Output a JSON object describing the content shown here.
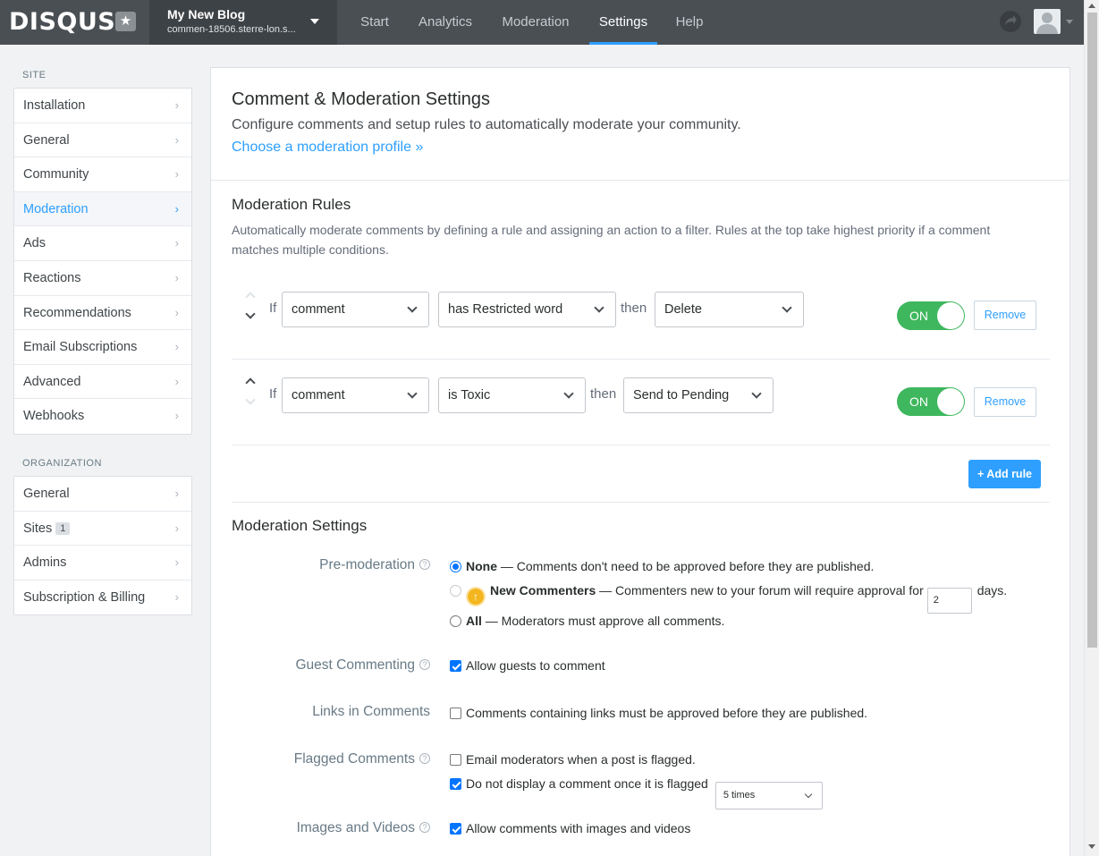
{
  "brand": {
    "logo_text": "DISQUS"
  },
  "site": {
    "name": "My New Blog",
    "url": "commen-18506.sterre-lon.s..."
  },
  "nav": {
    "tabs": [
      "Start",
      "Analytics",
      "Moderation",
      "Settings",
      "Help"
    ],
    "active": "Settings"
  },
  "sidebar": {
    "site_heading": "SITE",
    "site_items": [
      "Installation",
      "General",
      "Community",
      "Moderation",
      "Ads",
      "Reactions",
      "Recommendations",
      "Email Subscriptions",
      "Advanced",
      "Webhooks"
    ],
    "active_item": "Moderation",
    "org_heading": "ORGANIZATION",
    "org_items": [
      "General",
      "Sites",
      "Admins",
      "Subscription & Billing"
    ],
    "sites_count": "1"
  },
  "header": {
    "title": "Comment & Moderation Settings",
    "subtitle": "Configure comments and setup rules to automatically moderate your community.",
    "profile_link": "Choose a moderation profile »"
  },
  "rules": {
    "title": "Moderation Rules",
    "description": "Automatically moderate comments by defining a rule and assigning an action to a filter. Rules at the top take highest priority if a comment matches multiple conditions.",
    "if_label": "If",
    "then_label": "then",
    "items": [
      {
        "subject": "comment",
        "condition": "has Restricted word",
        "action": "Delete",
        "toggle": "ON",
        "remove": "Remove"
      },
      {
        "subject": "comment",
        "condition": "is Toxic",
        "action": "Send to Pending",
        "toggle": "ON",
        "remove": "Remove"
      }
    ],
    "add_button": "+ Add rule"
  },
  "settings": {
    "title": "Moderation Settings",
    "help_icon": "?",
    "premod": {
      "label": "Pre-moderation",
      "none_title": "None",
      "none_desc": " — Comments don't need to be approved before they are published.",
      "new_title": "New Commenters",
      "new_desc": " — Commenters new to your forum will require approval for",
      "days_value": "2",
      "days_label": "days.",
      "all_title": "All",
      "all_desc": " — Moderators must approve all comments.",
      "selected": "None"
    },
    "guest": {
      "label": "Guest Commenting",
      "option": "Allow guests to comment",
      "checked": true
    },
    "links": {
      "label": "Links in Comments",
      "option": "Comments containing links must be approved before they are published.",
      "checked": false
    },
    "flagged": {
      "label": "Flagged Comments",
      "email_option": "Email moderators when a post is flagged.",
      "email_checked": false,
      "hide_option": "Do not display a comment once it is flagged",
      "hide_checked": true,
      "times_value": "5 times"
    },
    "media": {
      "label": "Images and Videos",
      "option": "Allow comments with images and videos",
      "checked": true
    }
  },
  "colors": {
    "accent": "#2e9fff",
    "toggle_on": "#3fb75e",
    "topbar": "#4a4f54"
  }
}
